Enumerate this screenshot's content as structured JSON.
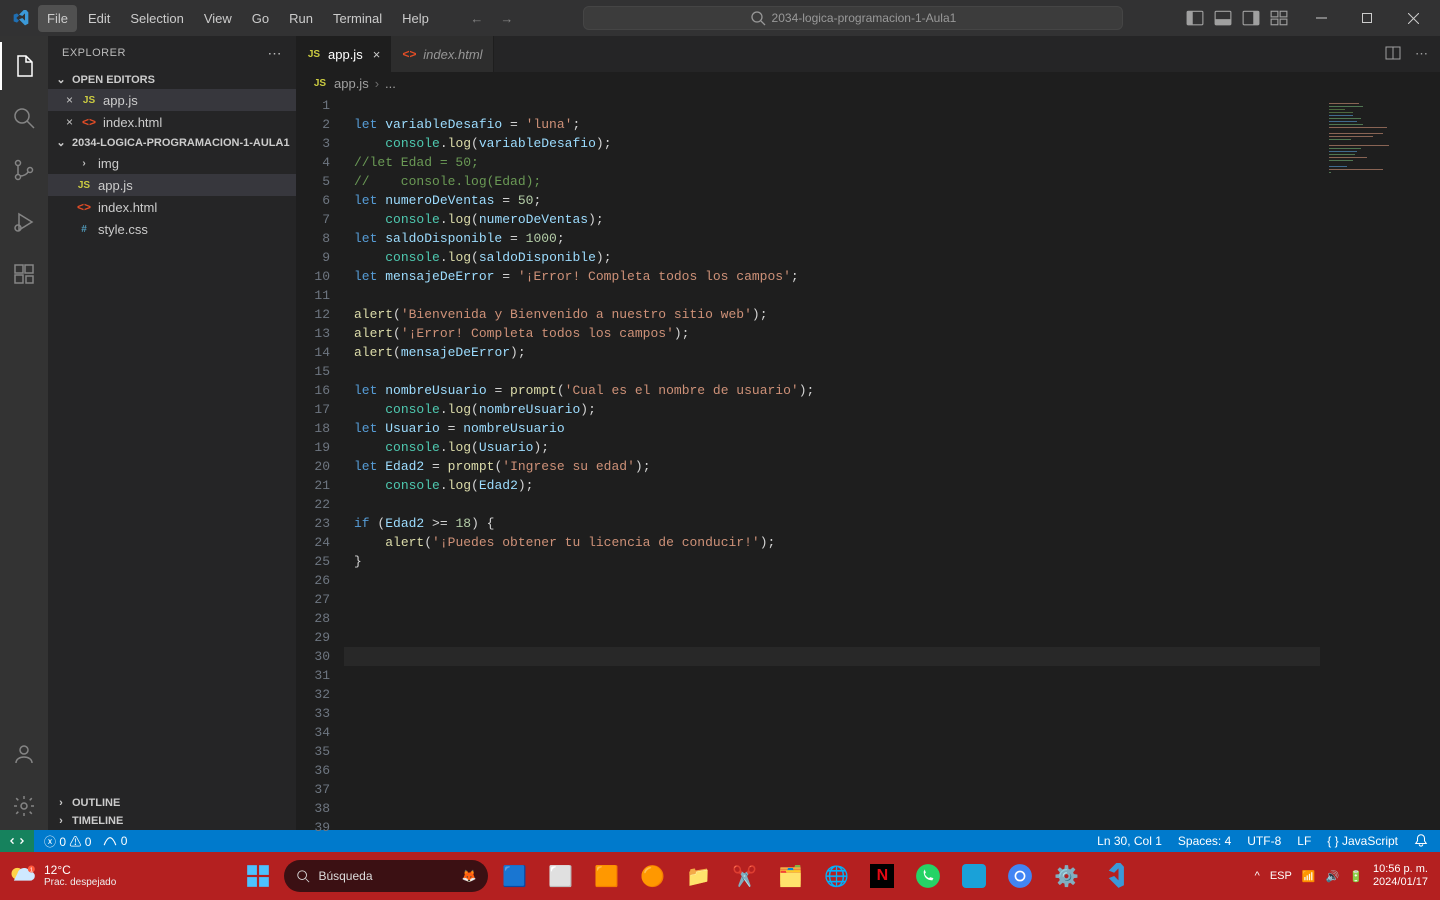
{
  "titlebar": {
    "menu": [
      "File",
      "Edit",
      "Selection",
      "View",
      "Go",
      "Run",
      "Terminal",
      "Help"
    ],
    "active_menu_index": 0,
    "search_text": "2034-logica-programacion-1-Aula1"
  },
  "sidebar": {
    "title": "EXPLORER",
    "sections": {
      "open_editors": "OPEN EDITORS",
      "project": "2034-LOGICA-PROGRAMACION-1-AULA1",
      "outline": "OUTLINE",
      "timeline": "TIMELINE"
    },
    "open_editors": [
      {
        "name": "app.js",
        "icon": "js",
        "modified": false
      },
      {
        "name": "index.html",
        "icon": "html",
        "modified": false
      }
    ],
    "tree": [
      {
        "name": "img",
        "icon": "folder",
        "indent": 1
      },
      {
        "name": "app.js",
        "icon": "js",
        "indent": 1,
        "selected": true
      },
      {
        "name": "index.html",
        "icon": "html",
        "indent": 1
      },
      {
        "name": "style.css",
        "icon": "css",
        "indent": 1
      }
    ]
  },
  "tabs": [
    {
      "name": "app.js",
      "icon": "js",
      "active": true
    },
    {
      "name": "index.html",
      "icon": "html",
      "active": false
    }
  ],
  "breadcrumb": {
    "file": "app.js",
    "more": "..."
  },
  "code_lines": [
    {
      "n": 1,
      "tokens": []
    },
    {
      "n": 2,
      "tokens": [
        [
          "kw",
          "let "
        ],
        [
          "var",
          "variableDesafio"
        ],
        [
          "op",
          " = "
        ],
        [
          "str",
          "'luna'"
        ],
        [
          "pun",
          ";"
        ]
      ]
    },
    {
      "n": 3,
      "tokens": [
        [
          "pun",
          "    "
        ],
        [
          "obj",
          "console"
        ],
        [
          "pun",
          "."
        ],
        [
          "fn",
          "log"
        ],
        [
          "pun",
          "("
        ],
        [
          "var",
          "variableDesafio"
        ],
        [
          "pun",
          ");"
        ]
      ]
    },
    {
      "n": 4,
      "tokens": [
        [
          "comm",
          "//let Edad = 50;"
        ]
      ]
    },
    {
      "n": 5,
      "tokens": [
        [
          "comm",
          "//    console.log(Edad);"
        ]
      ]
    },
    {
      "n": 6,
      "tokens": [
        [
          "kw",
          "let "
        ],
        [
          "var",
          "numeroDeVentas"
        ],
        [
          "op",
          " = "
        ],
        [
          "num",
          "50"
        ],
        [
          "pun",
          ";"
        ]
      ]
    },
    {
      "n": 7,
      "tokens": [
        [
          "pun",
          "    "
        ],
        [
          "obj",
          "console"
        ],
        [
          "pun",
          "."
        ],
        [
          "fn",
          "log"
        ],
        [
          "pun",
          "("
        ],
        [
          "var",
          "numeroDeVentas"
        ],
        [
          "pun",
          ");"
        ]
      ]
    },
    {
      "n": 8,
      "tokens": [
        [
          "kw",
          "let "
        ],
        [
          "var",
          "saldoDisponible"
        ],
        [
          "op",
          " = "
        ],
        [
          "num",
          "1000"
        ],
        [
          "pun",
          ";"
        ]
      ]
    },
    {
      "n": 9,
      "tokens": [
        [
          "pun",
          "    "
        ],
        [
          "obj",
          "console"
        ],
        [
          "pun",
          "."
        ],
        [
          "fn",
          "log"
        ],
        [
          "pun",
          "("
        ],
        [
          "var",
          "saldoDisponible"
        ],
        [
          "pun",
          ");"
        ]
      ]
    },
    {
      "n": 10,
      "tokens": [
        [
          "kw",
          "let "
        ],
        [
          "var",
          "mensajeDeError"
        ],
        [
          "op",
          " = "
        ],
        [
          "str",
          "'¡Error! Completa todos los campos'"
        ],
        [
          "pun",
          ";"
        ]
      ]
    },
    {
      "n": 11,
      "tokens": []
    },
    {
      "n": 12,
      "tokens": [
        [
          "fn",
          "alert"
        ],
        [
          "pun",
          "("
        ],
        [
          "str",
          "'Bienvenida y Bienvenido a nuestro sitio web'"
        ],
        [
          "pun",
          ");"
        ]
      ]
    },
    {
      "n": 13,
      "tokens": [
        [
          "fn",
          "alert"
        ],
        [
          "pun",
          "("
        ],
        [
          "str",
          "'¡Error! Completa todos los campos'"
        ],
        [
          "pun",
          ");"
        ]
      ]
    },
    {
      "n": 14,
      "tokens": [
        [
          "fn",
          "alert"
        ],
        [
          "pun",
          "("
        ],
        [
          "var",
          "mensajeDeError"
        ],
        [
          "pun",
          ");"
        ]
      ]
    },
    {
      "n": 15,
      "tokens": []
    },
    {
      "n": 16,
      "tokens": [
        [
          "kw",
          "let "
        ],
        [
          "var",
          "nombreUsuario"
        ],
        [
          "op",
          " = "
        ],
        [
          "fn",
          "prompt"
        ],
        [
          "pun",
          "("
        ],
        [
          "str",
          "'Cual es el nombre de usuario'"
        ],
        [
          "pun",
          ");"
        ]
      ]
    },
    {
      "n": 17,
      "tokens": [
        [
          "pun",
          "    "
        ],
        [
          "obj",
          "console"
        ],
        [
          "pun",
          "."
        ],
        [
          "fn",
          "log"
        ],
        [
          "pun",
          "("
        ],
        [
          "var",
          "nombreUsuario"
        ],
        [
          "pun",
          ");"
        ]
      ]
    },
    {
      "n": 18,
      "tokens": [
        [
          "kw",
          "let "
        ],
        [
          "var",
          "Usuario"
        ],
        [
          "op",
          " = "
        ],
        [
          "var",
          "nombreUsuario"
        ]
      ]
    },
    {
      "n": 19,
      "tokens": [
        [
          "pun",
          "    "
        ],
        [
          "obj",
          "console"
        ],
        [
          "pun",
          "."
        ],
        [
          "fn",
          "log"
        ],
        [
          "pun",
          "("
        ],
        [
          "var",
          "Usuario"
        ],
        [
          "pun",
          ");"
        ]
      ]
    },
    {
      "n": 20,
      "tokens": [
        [
          "kw",
          "let "
        ],
        [
          "var",
          "Edad2"
        ],
        [
          "op",
          " = "
        ],
        [
          "fn",
          "prompt"
        ],
        [
          "pun",
          "("
        ],
        [
          "str",
          "'Ingrese su edad'"
        ],
        [
          "pun",
          ");"
        ]
      ]
    },
    {
      "n": 21,
      "tokens": [
        [
          "pun",
          "    "
        ],
        [
          "obj",
          "console"
        ],
        [
          "pun",
          "."
        ],
        [
          "fn",
          "log"
        ],
        [
          "pun",
          "("
        ],
        [
          "var",
          "Edad2"
        ],
        [
          "pun",
          ");"
        ]
      ]
    },
    {
      "n": 22,
      "tokens": []
    },
    {
      "n": 23,
      "tokens": [
        [
          "kw",
          "if"
        ],
        [
          "pun",
          " ("
        ],
        [
          "var",
          "Edad2"
        ],
        [
          "op",
          " >= "
        ],
        [
          "num",
          "18"
        ],
        [
          "pun",
          ") {"
        ]
      ]
    },
    {
      "n": 24,
      "tokens": [
        [
          "pun",
          "    "
        ],
        [
          "fn",
          "alert"
        ],
        [
          "pun",
          "("
        ],
        [
          "str",
          "'¡Puedes obtener tu licencia de conducir!'"
        ],
        [
          "pun",
          ");"
        ]
      ]
    },
    {
      "n": 25,
      "tokens": [
        [
          "pun",
          "}"
        ]
      ]
    },
    {
      "n": 26,
      "tokens": []
    },
    {
      "n": 27,
      "tokens": []
    },
    {
      "n": 28,
      "tokens": []
    },
    {
      "n": 29,
      "tokens": []
    },
    {
      "n": 30,
      "tokens": [],
      "current": true
    },
    {
      "n": 31,
      "tokens": []
    },
    {
      "n": 32,
      "tokens": []
    },
    {
      "n": 33,
      "tokens": []
    },
    {
      "n": 34,
      "tokens": []
    },
    {
      "n": 35,
      "tokens": []
    },
    {
      "n": 36,
      "tokens": []
    },
    {
      "n": 37,
      "tokens": []
    },
    {
      "n": 38,
      "tokens": []
    },
    {
      "n": 39,
      "tokens": []
    }
  ],
  "statusbar": {
    "errors": "0",
    "warnings": "0",
    "ports": "0",
    "position": "Ln 30, Col 1",
    "spaces": "Spaces: 4",
    "encoding": "UTF-8",
    "eol": "LF",
    "lang": "JavaScript"
  },
  "taskbar": {
    "weather": {
      "temp": "12°C",
      "cond": "Prac. despejado"
    },
    "search_placeholder": "Búsqueda",
    "clock": {
      "time": "10:56 p. m.",
      "date": "2024/01/17"
    },
    "apps": [
      "start",
      "search",
      "copilot",
      "task-view",
      "widgets",
      "powerpoint",
      "xampp",
      "files",
      "snip",
      "edge",
      "mail",
      "netflix",
      "whatsapp",
      "prime",
      "chrome",
      "settings",
      "vscode"
    ]
  }
}
